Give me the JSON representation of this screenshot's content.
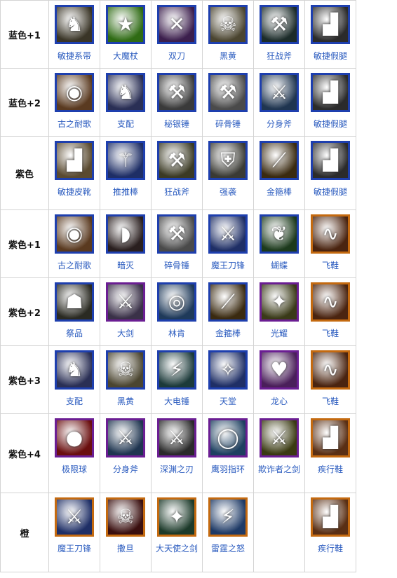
{
  "rows": [
    {
      "label": "蓝色+1",
      "items": [
        {
          "name": "敏捷系带",
          "icon": "helmet-icon",
          "glyph": "♞",
          "bg": "#3a3527",
          "frame": "blue"
        },
        {
          "name": "大魔杖",
          "icon": "star-wand-icon",
          "glyph": "★",
          "bg": "#2f6b14",
          "frame": "blue"
        },
        {
          "name": "双刀",
          "icon": "twin-blades-icon",
          "glyph": "✕",
          "bg": "#3c1f4d",
          "frame": "blue"
        },
        {
          "name": "黑黄",
          "icon": "skull-staff-icon",
          "glyph": "☠",
          "bg": "#4b4530",
          "frame": "blue"
        },
        {
          "name": "狂战斧",
          "icon": "axe-icon",
          "glyph": "⚒",
          "bg": "#1c2c2a",
          "frame": "blue"
        },
        {
          "name": "敏捷假腿",
          "icon": "boot-icon",
          "glyph": "▟",
          "bg": "#2b2b2b",
          "frame": "blue"
        }
      ]
    },
    {
      "label": "蓝色+2",
      "items": [
        {
          "name": "古之耐歌",
          "icon": "drum-icon",
          "glyph": "◉",
          "bg": "#5a3a20",
          "frame": "blue"
        },
        {
          "name": "支配",
          "icon": "helmet-icon",
          "glyph": "♞",
          "bg": "#2a2f55",
          "frame": "blue"
        },
        {
          "name": "秘银锤",
          "icon": "hammer-icon",
          "glyph": "⚒",
          "bg": "#3a3a3a",
          "frame": "blue"
        },
        {
          "name": "碎骨锤",
          "icon": "hammer-icon",
          "glyph": "⚒",
          "bg": "#4a4a4a",
          "frame": "blue"
        },
        {
          "name": "分身斧",
          "icon": "axe-icon",
          "glyph": "⚔",
          "bg": "#1f3550",
          "frame": "blue"
        },
        {
          "name": "敏捷假腿",
          "icon": "boot-icon",
          "glyph": "▟",
          "bg": "#2b2b2b",
          "frame": "blue"
        }
      ]
    },
    {
      "label": "紫色",
      "items": [
        {
          "name": "敏捷皮靴",
          "icon": "boot-icon",
          "glyph": "▟",
          "bg": "#5a4a30",
          "frame": "blue"
        },
        {
          "name": "推推棒",
          "icon": "staff-icon",
          "glyph": "⚚",
          "bg": "#1e2e66",
          "frame": "blue"
        },
        {
          "name": "狂战斧",
          "icon": "axe-icon",
          "glyph": "⚒",
          "bg": "#3b3a24",
          "frame": "blue"
        },
        {
          "name": "强袭",
          "icon": "armor-icon",
          "glyph": "⛨",
          "bg": "#3a3a34",
          "frame": "blue"
        },
        {
          "name": "金箍棒",
          "icon": "rod-icon",
          "glyph": "⟋",
          "bg": "#3a2a10",
          "frame": "blue"
        },
        {
          "name": "敏捷假腿",
          "icon": "boot-icon",
          "glyph": "▟",
          "bg": "#2b2b2b",
          "frame": "blue"
        }
      ]
    },
    {
      "label": "紫色+1",
      "items": [
        {
          "name": "古之耐歌",
          "icon": "drum-icon",
          "glyph": "◉",
          "bg": "#5a3a20",
          "frame": "blue"
        },
        {
          "name": "暗灭",
          "icon": "blade-icon",
          "glyph": "◗",
          "bg": "#2a1f1f",
          "frame": "blue"
        },
        {
          "name": "碎骨锤",
          "icon": "hammer-icon",
          "glyph": "⚒",
          "bg": "#4a4a4a",
          "frame": "blue"
        },
        {
          "name": "魔王刀锋",
          "icon": "sword-icon",
          "glyph": "⚔",
          "bg": "#1f2f66",
          "frame": "blue"
        },
        {
          "name": "蝴蝶",
          "icon": "butterfly-icon",
          "glyph": "❦",
          "bg": "#1c3a1c",
          "frame": "blue"
        },
        {
          "name": "飞鞋",
          "icon": "winged-boot-icon",
          "glyph": "∿",
          "bg": "#4a2410",
          "frame": "orange"
        }
      ]
    },
    {
      "label": "紫色+2",
      "items": [
        {
          "name": "祭品",
          "icon": "hood-icon",
          "glyph": "☗",
          "bg": "#2a2a22",
          "frame": "blue"
        },
        {
          "name": "大剑",
          "icon": "greatsword-icon",
          "glyph": "⚔",
          "bg": "#3a3148",
          "frame": "purple"
        },
        {
          "name": "林肯",
          "icon": "orb-icon",
          "glyph": "◎",
          "bg": "#1f3a5a",
          "frame": "blue"
        },
        {
          "name": "金箍棒",
          "icon": "rod-icon",
          "glyph": "⟋",
          "bg": "#3a2a10",
          "frame": "blue"
        },
        {
          "name": "光耀",
          "icon": "sword-icon",
          "glyph": "✦",
          "bg": "#3a3a18",
          "frame": "purple"
        },
        {
          "name": "飞鞋",
          "icon": "winged-boot-icon",
          "glyph": "∿",
          "bg": "#4a2410",
          "frame": "orange"
        }
      ]
    },
    {
      "label": "紫色+3",
      "items": [
        {
          "name": "支配",
          "icon": "helmet-icon",
          "glyph": "♞",
          "bg": "#2a2f55",
          "frame": "blue"
        },
        {
          "name": "黑黄",
          "icon": "skull-staff-icon",
          "glyph": "☠",
          "bg": "#4b4530",
          "frame": "blue"
        },
        {
          "name": "大电锤",
          "icon": "hammer-icon",
          "glyph": "⚡",
          "bg": "#1c3a3a",
          "frame": "blue"
        },
        {
          "name": "天堂",
          "icon": "halberd-icon",
          "glyph": "✧",
          "bg": "#1f2f66",
          "frame": "blue"
        },
        {
          "name": "龙心",
          "icon": "heart-icon",
          "glyph": "♥",
          "bg": "#4a1f5a",
          "frame": "purple"
        },
        {
          "name": "飞鞋",
          "icon": "winged-boot-icon",
          "glyph": "∿",
          "bg": "#4a2410",
          "frame": "orange"
        }
      ]
    },
    {
      "label": "紫色+4",
      "items": [
        {
          "name": "极限球",
          "icon": "red-orb-icon",
          "glyph": "●",
          "bg": "#6a0f0f",
          "frame": "purple"
        },
        {
          "name": "分身斧",
          "icon": "axe-icon",
          "glyph": "⚔",
          "bg": "#1f3550",
          "frame": "purple"
        },
        {
          "name": "深渊之刃",
          "icon": "abyssal-blade-icon",
          "glyph": "⚔",
          "bg": "#2a2a2a",
          "frame": "purple"
        },
        {
          "name": "鹰羽指环",
          "icon": "ring-icon",
          "glyph": "◯",
          "bg": "#1e4060",
          "frame": "purple"
        },
        {
          "name": "欺诈者之剑",
          "icon": "trickster-sword-icon",
          "glyph": "⚔",
          "bg": "#3a3a12",
          "frame": "purple"
        },
        {
          "name": "疾行鞋",
          "icon": "travel-boot-icon",
          "glyph": "▟",
          "bg": "#5a2f14",
          "frame": "orange"
        }
      ]
    },
    {
      "label": "橙",
      "items": [
        {
          "name": "魔王刀锋",
          "icon": "sword-icon",
          "glyph": "⚔",
          "bg": "#1f2f66",
          "frame": "orange"
        },
        {
          "name": "撒旦",
          "icon": "satanic-icon",
          "glyph": "☠",
          "bg": "#3a0f0f",
          "frame": "orange"
        },
        {
          "name": "大天使之剑",
          "icon": "archangel-sword-icon",
          "glyph": "✦",
          "bg": "#1c3a2a",
          "frame": "orange"
        },
        {
          "name": "雷霆之怒",
          "icon": "thunder-icon",
          "glyph": "⚡",
          "bg": "#1e3a66",
          "frame": "orange"
        },
        null,
        {
          "name": "疾行鞋",
          "icon": "travel-boot-icon",
          "glyph": "▟",
          "bg": "#5a2f14",
          "frame": "orange"
        }
      ]
    }
  ]
}
